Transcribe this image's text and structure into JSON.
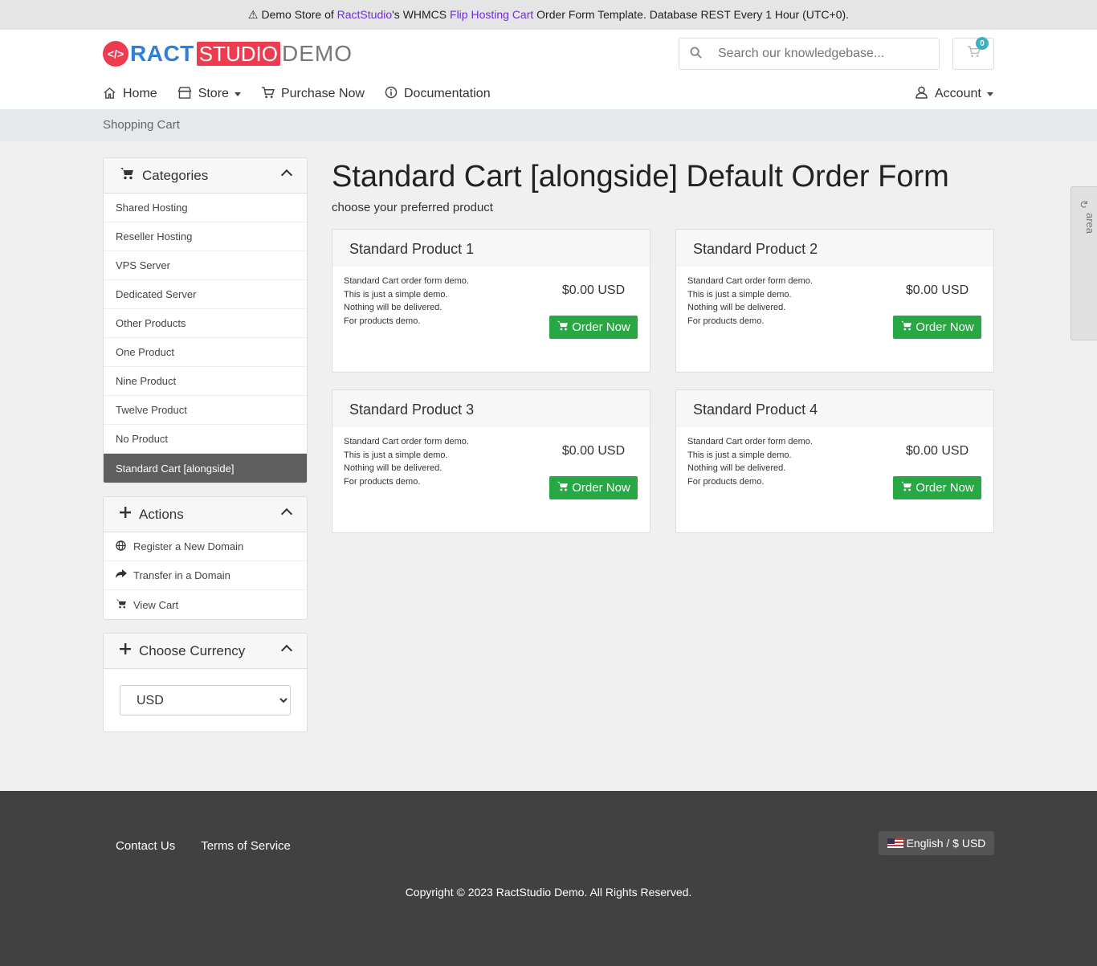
{
  "notice": {
    "prefix": "Demo Store of ",
    "brand": "RactStudio",
    "middle": "'s WHMCS ",
    "product": "Flip Hosting Cart",
    "suffix": " Order Form Template. Database REST Every 1 Hour (UTC+0)."
  },
  "logo": {
    "ract": "RACT",
    "studio": "STUDIO",
    "demo": "DEMO"
  },
  "search": {
    "placeholder": "Search our knowledgebase..."
  },
  "cart": {
    "count": "0"
  },
  "nav": {
    "home": "Home",
    "store": "Store",
    "purchase": "Purchase Now",
    "documentation": "Documentation",
    "account": "Account"
  },
  "breadcrumb": "Shopping Cart",
  "sidebar": {
    "categories_title": "Categories",
    "categories": [
      "Shared Hosting",
      "Reseller Hosting",
      "VPS Server",
      "Dedicated Server",
      "Other Products",
      "One Product",
      "Nine Product",
      "Twelve Product",
      "No Product",
      "Standard Cart [alongside]"
    ],
    "actions_title": "Actions",
    "actions": [
      "Register a New Domain",
      "Transfer in a Domain",
      "View Cart"
    ],
    "currency_title": "Choose Currency",
    "currency_value": "USD"
  },
  "main": {
    "title": "Standard Cart [alongside] Default Order Form",
    "subtitle": "choose your preferred product",
    "order_label": "Order Now",
    "desc_lines": [
      "Standard Cart order form demo.",
      "This is just a simple demo.",
      "Nothing will be delivered.",
      "For products demo."
    ],
    "products": [
      {
        "name": "Standard Product 1",
        "price": "$0.00 USD"
      },
      {
        "name": "Standard Product 2",
        "price": "$0.00 USD"
      },
      {
        "name": "Standard Product 3",
        "price": "$0.00 USD"
      },
      {
        "name": "Standard Product 4",
        "price": "$0.00 USD"
      }
    ]
  },
  "admin_tab": "Return to admin area",
  "footer": {
    "contact": "Contact Us",
    "terms": "Terms of Service",
    "language": "English / $ USD",
    "copyright": "Copyright © 2023 RactStudio Demo. All Rights Reserved."
  },
  "colors": {
    "accent": "#28a745",
    "brand_red": "#ef3b50",
    "brand_blue": "#2d7fd8",
    "footer_bg": "#414141"
  }
}
